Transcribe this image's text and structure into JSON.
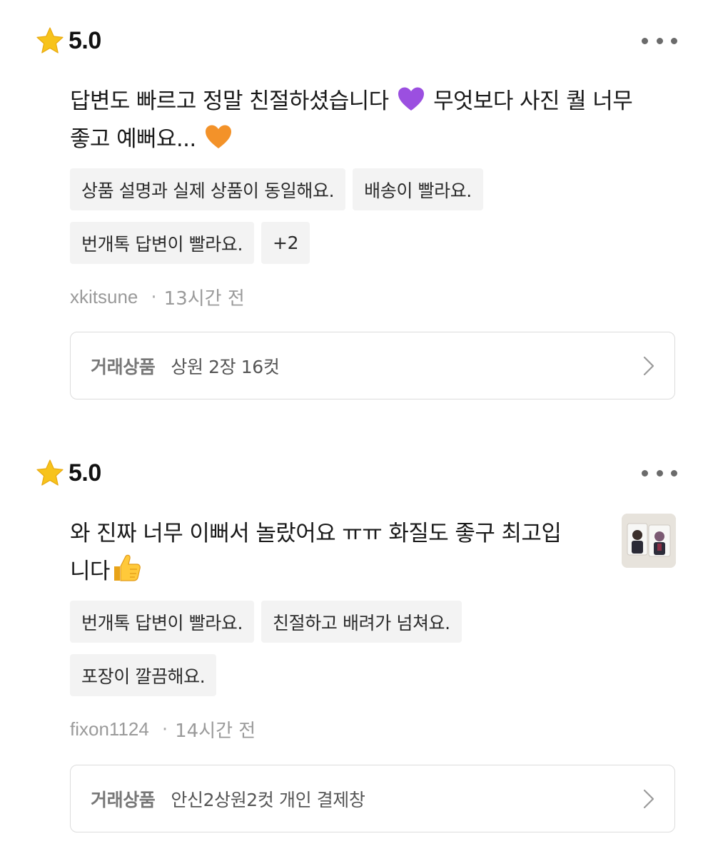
{
  "reviews": [
    {
      "rating": "5.0",
      "text_line1": "답변도 빠르고 정말 친절하셨습니다",
      "text_line1b": "무엇보다 사진 퀄 너무",
      "text_line2": "좋고 예뻐요...",
      "emoji1": "purple-heart-icon",
      "emoji2": "orange-heart-icon",
      "tags_row1": [
        "상품 설명과 실제 상품이 동일해요.",
        "배송이 빨라요."
      ],
      "tags_row2": [
        "번개톡 답변이 빨라요.",
        "+2"
      ],
      "author": "xkitsune",
      "time": "13시간 전",
      "product_label": "거래상품",
      "product_name": "상원 2장 16컷"
    },
    {
      "rating": "5.0",
      "text_line1": "와 진짜 너무 이뻐서 놀랐어요 ㅠㅠ 화질도 좋구 최고입",
      "text_line2": "니다",
      "emoji1": "thumbs-up-icon",
      "tags_row1": [
        "번개톡 답변이 빨라요.",
        "친절하고 배려가 넘쳐요."
      ],
      "tags_row2": [
        "포장이 깔끔해요."
      ],
      "author": "fixon1124",
      "time": "14시간 전",
      "product_label": "거래상품",
      "product_name": "안신2상원2컷 개인 결제창",
      "thumbnail": "photo-card-thumbnail"
    }
  ],
  "colors": {
    "star": "#F7C31B",
    "purple_heart": "#9B4FE0",
    "orange_heart": "#F39229",
    "tag_bg": "#F3F3F3"
  }
}
